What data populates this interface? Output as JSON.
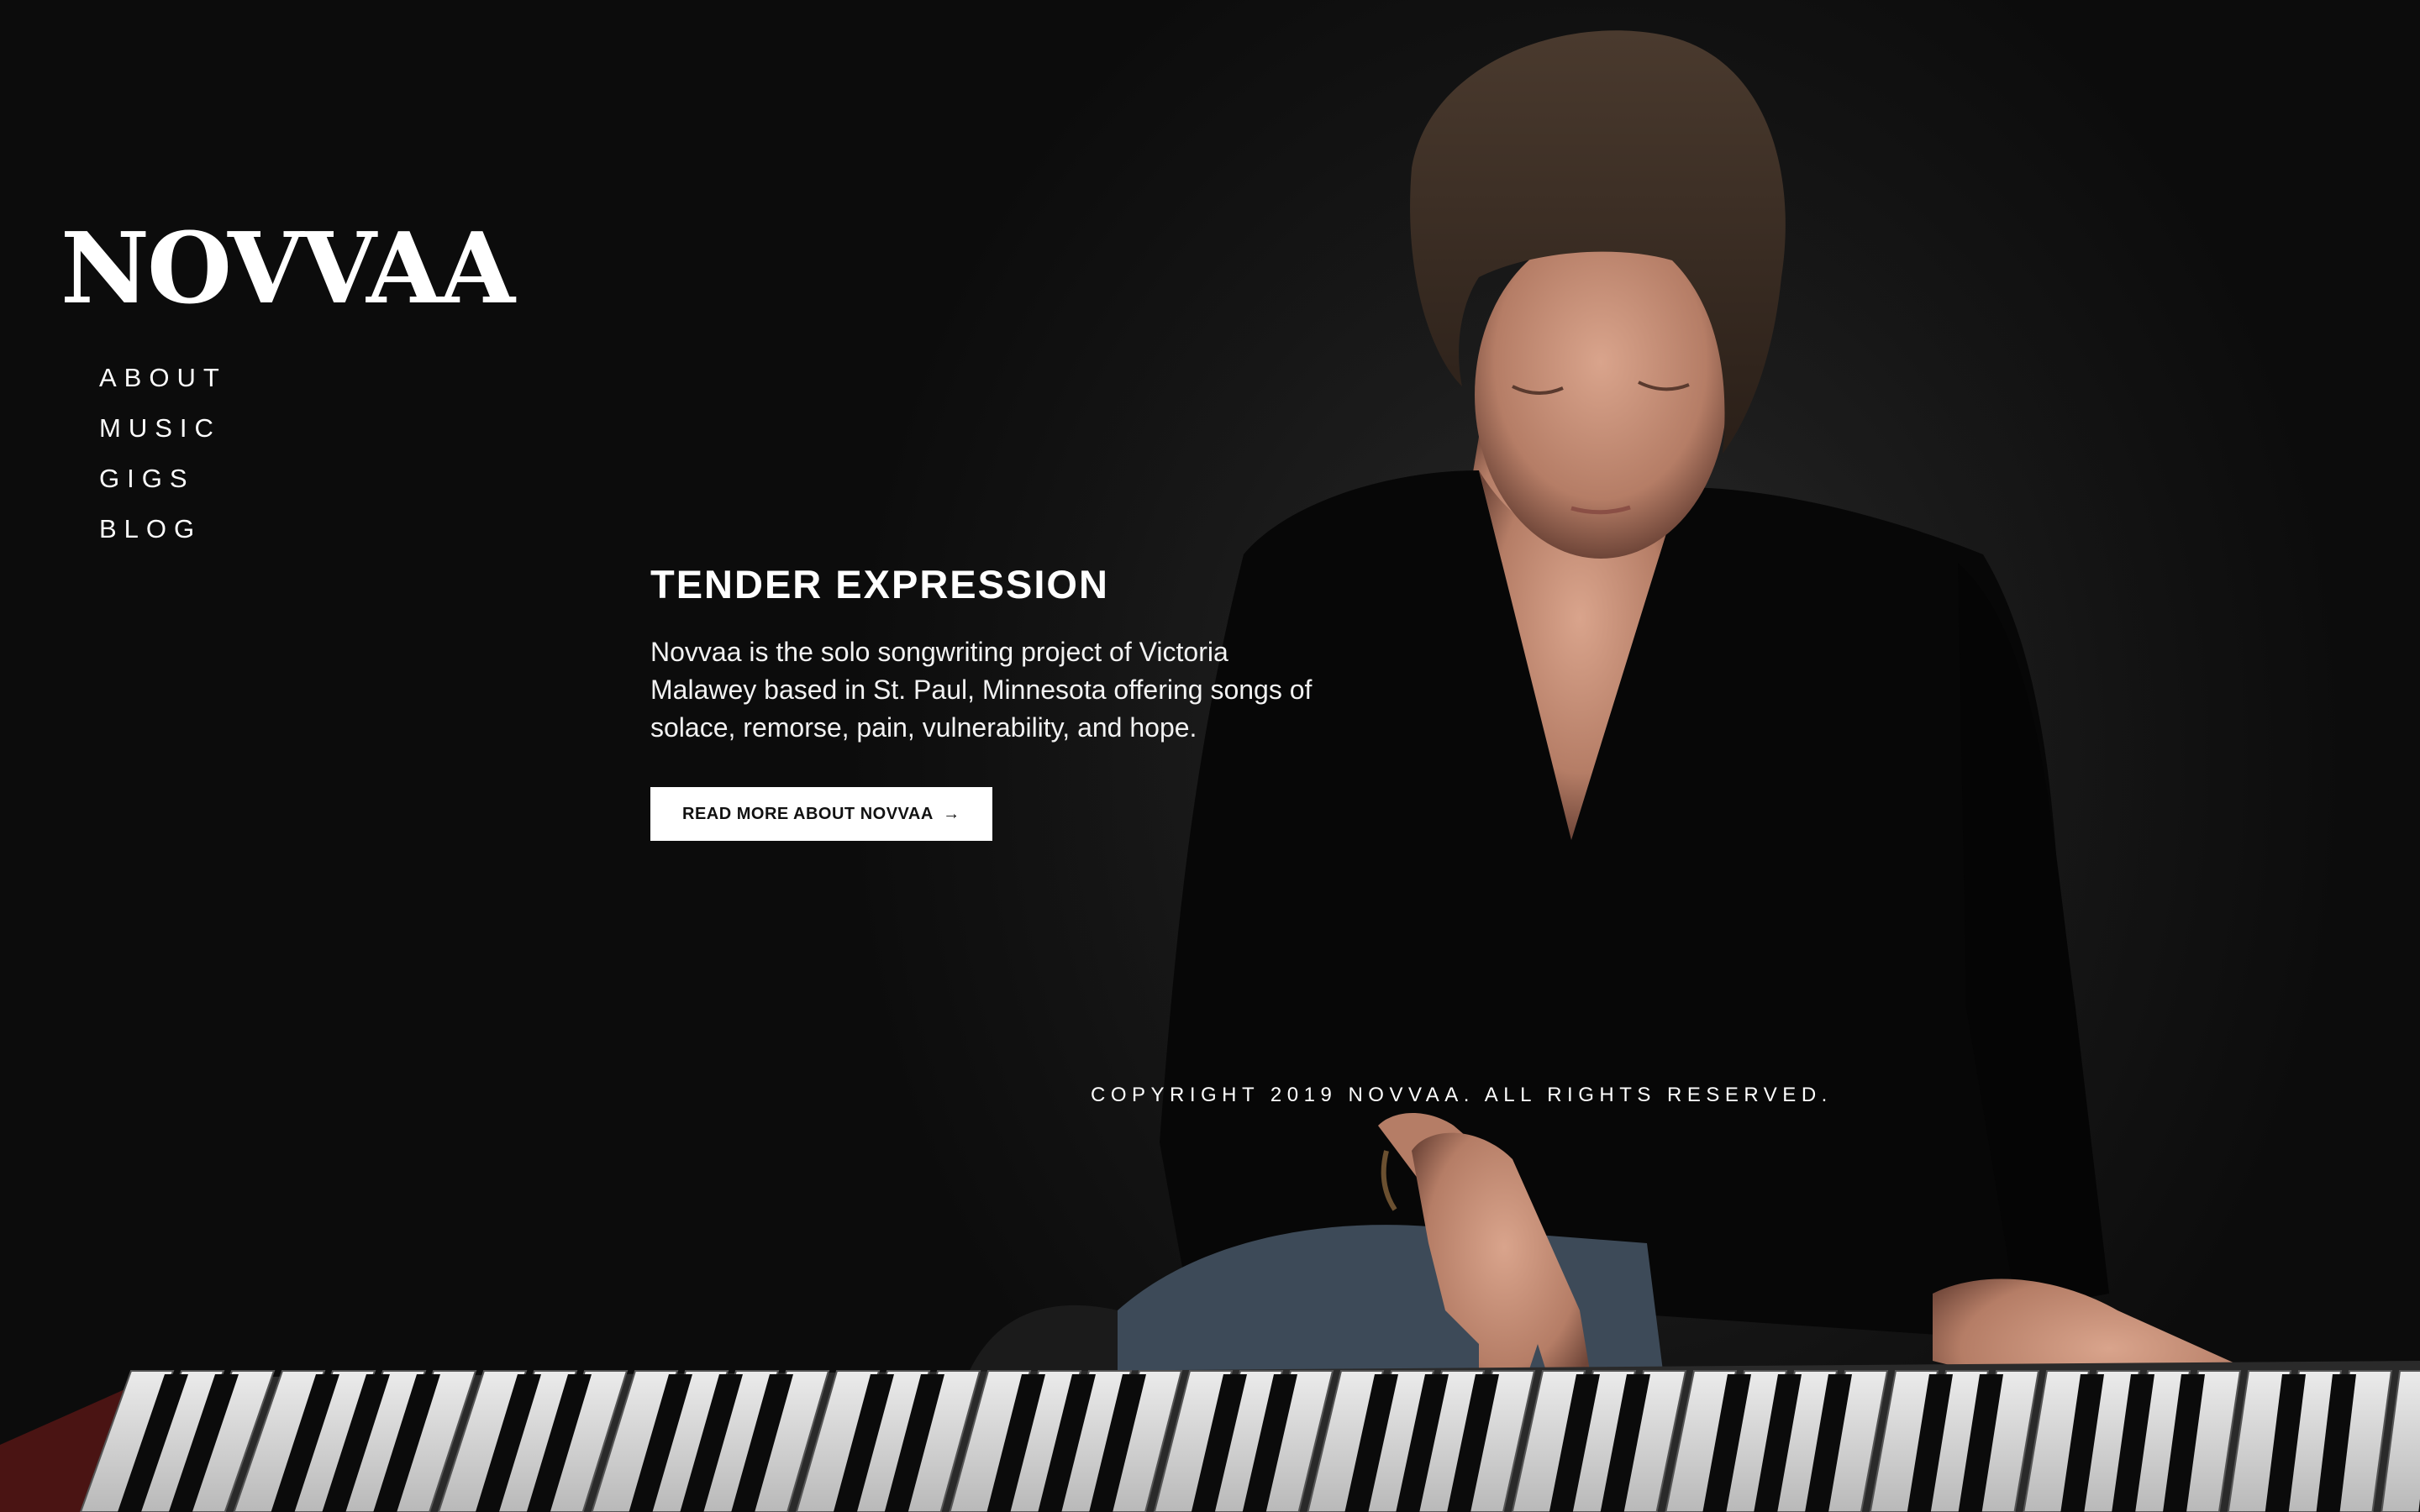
{
  "brand": {
    "logo_text": "NOVVAA"
  },
  "nav": {
    "items": [
      {
        "label": "ABOUT"
      },
      {
        "label": "MUSIC"
      },
      {
        "label": "GIGS"
      },
      {
        "label": "BLOG"
      }
    ]
  },
  "hero": {
    "headline": "TENDER EXPRESSION",
    "intro": "Novvaa is the solo songwriting project of Victoria Malawey based in St. Paul, Minnesota offering songs of solace, remorse, pain, vulnerability, and hope.",
    "cta_label": "READ MORE ABOUT NOVVAA",
    "cta_arrow": "→",
    "background_image": "woman in black v-neck top playing a piano keyboard in a dark room"
  },
  "footer": {
    "copyright": "COPYRIGHT 2019 NOVVAA. ALL RIGHTS RESERVED."
  },
  "colors": {
    "background": "#111111",
    "text": "#ffffff",
    "button_bg": "#ffffff",
    "button_text": "#111111"
  }
}
